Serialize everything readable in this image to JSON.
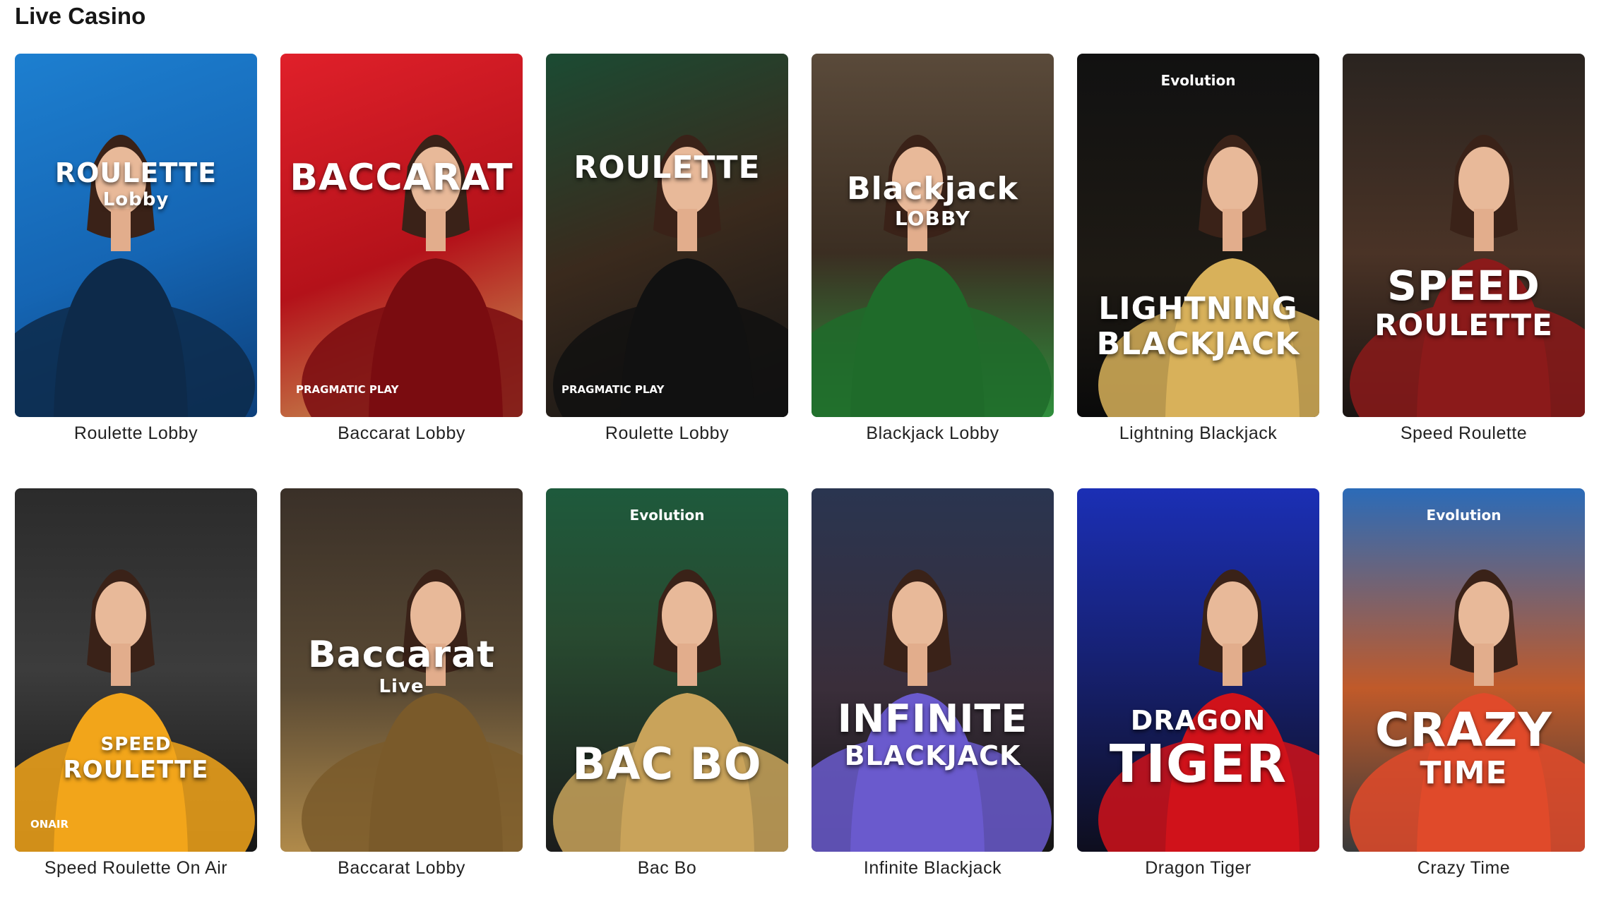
{
  "section": {
    "title": "Live Casino"
  },
  "games": [
    {
      "label": "Roulette Lobby",
      "logo1": "ROULETTE",
      "logo2": "Lobby",
      "provider": "",
      "bg": "linear-gradient(160deg,#1d7fd0 0%,#1565b3 55%,#0c3f7a 100%)",
      "accent": "#0d2a4a"
    },
    {
      "label": "Baccarat Lobby",
      "logo1": "BACCARAT",
      "logo2": "",
      "provider": "PRAGMATIC PLAY",
      "bg": "linear-gradient(160deg,#e0202a 0%,#b4121a 55%,#c9a35a 100%)",
      "accent": "#7a0c10"
    },
    {
      "label": "Roulette Lobby",
      "logo1": "ROULETTE",
      "logo2": "",
      "provider": "PRAGMATIC PLAY",
      "bg": "linear-gradient(160deg,#1b4b33 0%,#3a2a1d 50%,#151515 100%)",
      "accent": "#111111"
    },
    {
      "label": "Blackjack Lobby",
      "logo1": "Blackjack",
      "logo2": "LOBBY",
      "provider": "",
      "bg": "linear-gradient(180deg,#5a4a3a 0%,#3b2e22 55%,#2f8f3c 100%)",
      "accent": "#1f6b2a"
    },
    {
      "label": "Lightning Blackjack",
      "logo1": "LIGHTNING",
      "logo2": "BLACKJACK",
      "provider": "Evolution",
      "bg": "linear-gradient(180deg,#111111 0%,#1e1a14 60%,#0a0a0a 100%)",
      "accent": "#d8b15a"
    },
    {
      "label": "Speed Roulette",
      "logo1": "SPEED",
      "logo2": "ROULETTE",
      "provider": "",
      "bg": "linear-gradient(180deg,#2a2420 0%,#4a3326 55%,#1a1412 100%)",
      "accent": "#8b1a1a"
    },
    {
      "label": "Speed Roulette On Air",
      "logo1": "SPEED",
      "logo2": "ROULETTE",
      "provider": "ONAIR",
      "bg": "linear-gradient(180deg,#2b2b2b 0%,#3c3c3c 50%,#161616 100%)",
      "accent": "#f2a51a"
    },
    {
      "label": "Baccarat Lobby",
      "logo1": "Baccarat",
      "logo2": "Live",
      "provider": "",
      "bg": "linear-gradient(180deg,#3a3028 0%,#5a4a34 55%,#b08a4a 100%)",
      "accent": "#7a5a2a"
    },
    {
      "label": "Bac Bo",
      "logo1": "BAC BO",
      "logo2": "",
      "provider": "Evolution",
      "bg": "linear-gradient(180deg,#1e5a3c 0%,#284a30 40%,#1c1c1c 100%)",
      "accent": "#c9a35a"
    },
    {
      "label": "Infinite Blackjack",
      "logo1": "INFINITE",
      "logo2": "BLACKJACK",
      "provider": "",
      "bg": "linear-gradient(180deg,#2a3550 0%,#3a2e3a 55%,#151515 100%)",
      "accent": "#6a5acd"
    },
    {
      "label": "Dragon Tiger",
      "logo1": "DRAGON",
      "logo2": "TIGER",
      "provider": "",
      "bg": "linear-gradient(180deg,#1b2fb5 0%,#16206e 50%,#0e0e1e 100%)",
      "accent": "#d0121a"
    },
    {
      "label": "Crazy Time",
      "logo1": "CRAZY",
      "logo2": "TIME",
      "provider": "Evolution",
      "bg": "linear-gradient(180deg,#2b6bb8 0%,#c05a2a 55%,#3a3a3a 100%)",
      "accent": "#e04a2a"
    }
  ]
}
